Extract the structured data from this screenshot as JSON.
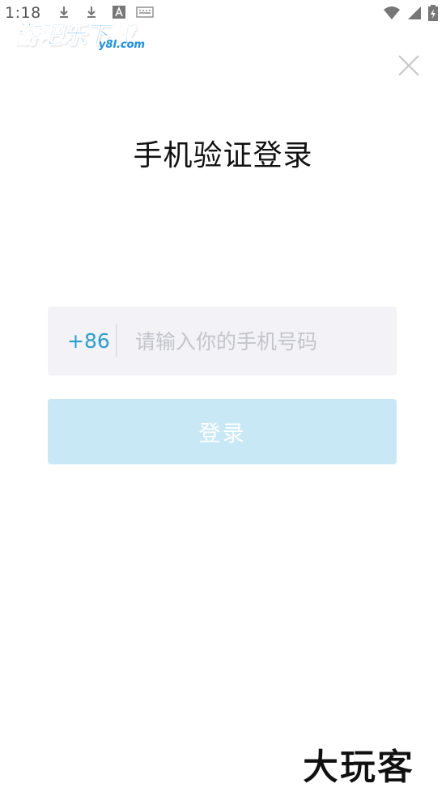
{
  "status_bar": {
    "time": "1:18",
    "icons": [
      "download-icon",
      "download-icon",
      "keyboard-a-icon",
      "keyboard-icon",
      "wifi-icon",
      "signal-icon",
      "battery-charging-icon"
    ]
  },
  "watermark_top": {
    "main": "游吧乐下载",
    "sub": "y8l.com"
  },
  "close": {
    "icon": "close-icon"
  },
  "title": "手机验证登录",
  "phone": {
    "country_code": "+86",
    "value": "",
    "placeholder": "请输入你的手机号码"
  },
  "login_button": {
    "label": "登录"
  },
  "watermark_bottom": "大玩客",
  "colors": {
    "accent": "#2a9fd0",
    "button_disabled": "#c8e8f5",
    "field_bg": "#f2f2f7",
    "logo_blue": "#1a8fe6"
  }
}
